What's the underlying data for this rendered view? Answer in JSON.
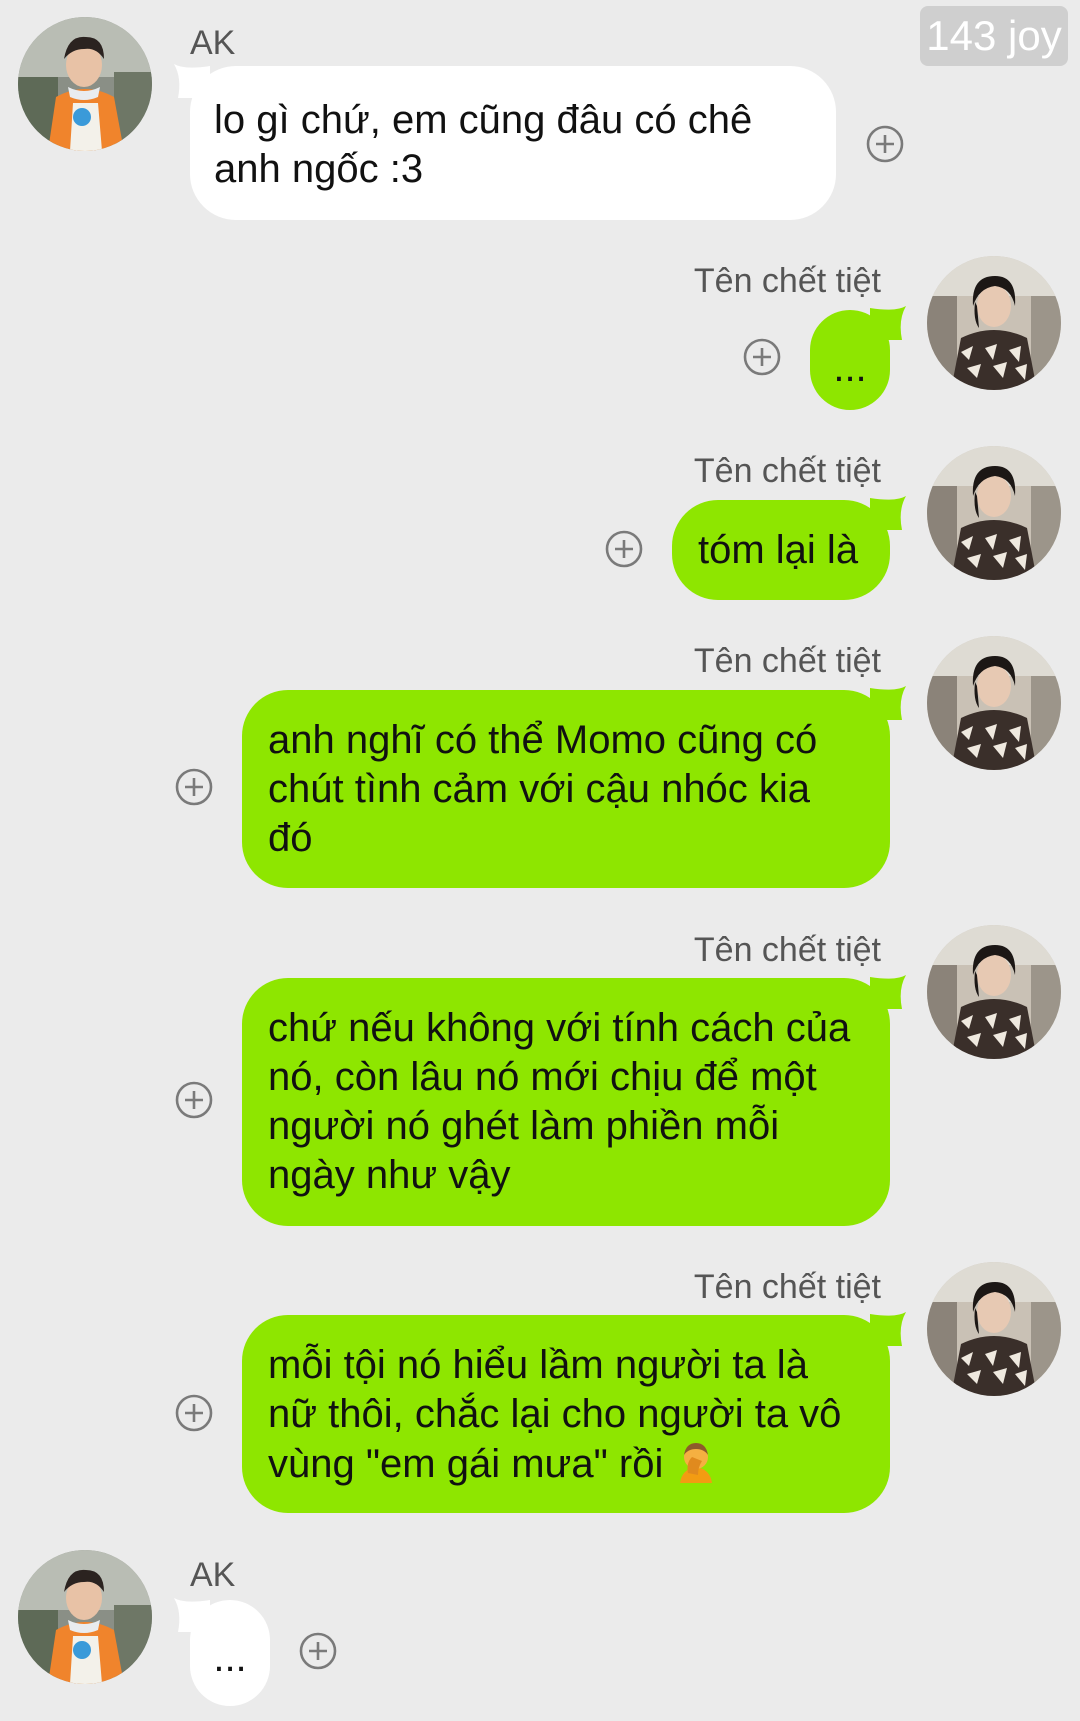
{
  "watermark": "143 joy",
  "contacts": {
    "other": "AK",
    "self": "Tên chết tiệt"
  },
  "messages": [
    {
      "side": "in",
      "sender": "AK",
      "text": "lo gì chứ, em cũng đâu có chê anh ngốc :3"
    },
    {
      "side": "out",
      "sender": "Tên chết tiệt",
      "text": "..."
    },
    {
      "side": "out",
      "sender": "Tên chết tiệt",
      "text": "tóm lại là"
    },
    {
      "side": "out",
      "sender": "Tên chết tiệt",
      "text": "anh nghĩ có thể Momo cũng có chút tình cảm với cậu nhóc kia đó"
    },
    {
      "side": "out",
      "sender": "Tên chết tiệt",
      "text": "chứ nếu không với tính cách của nó, còn lâu nó mới chịu để một người nó ghét làm phiền mỗi ngày như vậy"
    },
    {
      "side": "out",
      "sender": "Tên chết tiệt",
      "text": "mỗi tội nó hiểu lầm người ta là nữ thôi, chắc lại cho người ta vô vùng \"em gái mưa\" rồi",
      "emoji": "person-facepalming"
    },
    {
      "side": "in",
      "sender": "AK",
      "text": "..."
    }
  ],
  "icons": {
    "add": "plus-circle-icon"
  },
  "colors": {
    "background": "#ebebeb",
    "incoming_bubble": "#ffffff",
    "outgoing_bubble": "#8ee600",
    "name_text": "#555555"
  }
}
